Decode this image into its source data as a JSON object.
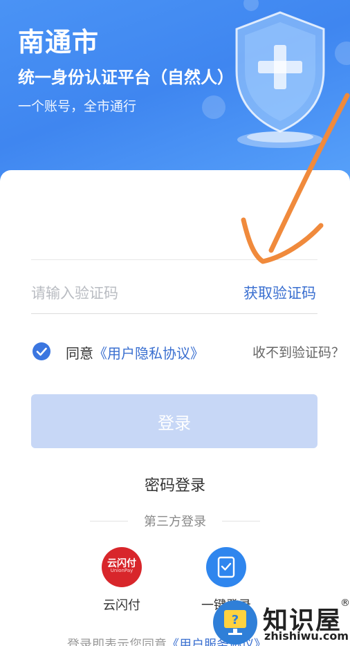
{
  "header": {
    "city": "南通市",
    "platform": "统一身份认证平台（自然人）",
    "slogan": "一个账号，全市通行"
  },
  "form": {
    "code_placeholder": "请输入验证码",
    "get_code_label": "获取验证码",
    "agree_prefix": "同意",
    "agree_link": "《用户隐私协议》",
    "no_code_label": "收不到验证码？",
    "login_button": "登录",
    "password_login": "密码登录"
  },
  "third_party": {
    "title": "第三方登录",
    "items": [
      {
        "label": "云闪付",
        "icon": "unionpay-icon",
        "icon_text": "云闪付",
        "icon_sub": "UnionPay"
      },
      {
        "label": "一键登录",
        "icon": "tablet-check-icon"
      }
    ]
  },
  "footer": {
    "note_prefix": "登录即表示您同意",
    "note_link": "《用户服务协议》"
  },
  "watermark": {
    "name": "知识屋",
    "domain": "zhishiwu.com",
    "mark": "®"
  },
  "colors": {
    "hero": "#4a93f5",
    "accent": "#3a6fd0",
    "button_disabled": "#c7d7f6",
    "annotation_arrow": "#f08a3c"
  }
}
